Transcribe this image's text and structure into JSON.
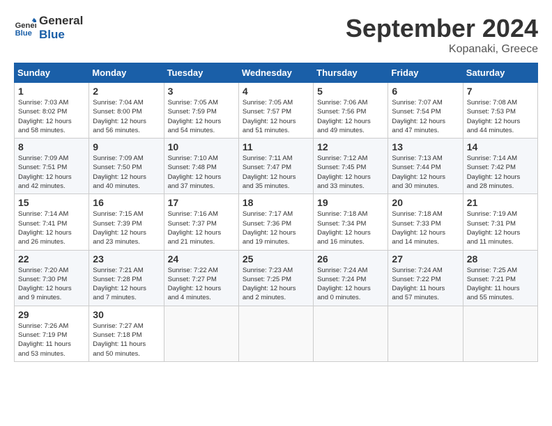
{
  "header": {
    "logo_line1": "General",
    "logo_line2": "Blue",
    "month_year": "September 2024",
    "location": "Kopanaki, Greece"
  },
  "weekdays": [
    "Sunday",
    "Monday",
    "Tuesday",
    "Wednesday",
    "Thursday",
    "Friday",
    "Saturday"
  ],
  "weeks": [
    [
      {
        "day": "1",
        "sunrise": "7:03 AM",
        "sunset": "8:02 PM",
        "daylight": "12 hours and 58 minutes."
      },
      {
        "day": "2",
        "sunrise": "7:04 AM",
        "sunset": "8:00 PM",
        "daylight": "12 hours and 56 minutes."
      },
      {
        "day": "3",
        "sunrise": "7:05 AM",
        "sunset": "7:59 PM",
        "daylight": "12 hours and 54 minutes."
      },
      {
        "day": "4",
        "sunrise": "7:05 AM",
        "sunset": "7:57 PM",
        "daylight": "12 hours and 51 minutes."
      },
      {
        "day": "5",
        "sunrise": "7:06 AM",
        "sunset": "7:56 PM",
        "daylight": "12 hours and 49 minutes."
      },
      {
        "day": "6",
        "sunrise": "7:07 AM",
        "sunset": "7:54 PM",
        "daylight": "12 hours and 47 minutes."
      },
      {
        "day": "7",
        "sunrise": "7:08 AM",
        "sunset": "7:53 PM",
        "daylight": "12 hours and 44 minutes."
      }
    ],
    [
      {
        "day": "8",
        "sunrise": "7:09 AM",
        "sunset": "7:51 PM",
        "daylight": "12 hours and 42 minutes."
      },
      {
        "day": "9",
        "sunrise": "7:09 AM",
        "sunset": "7:50 PM",
        "daylight": "12 hours and 40 minutes."
      },
      {
        "day": "10",
        "sunrise": "7:10 AM",
        "sunset": "7:48 PM",
        "daylight": "12 hours and 37 minutes."
      },
      {
        "day": "11",
        "sunrise": "7:11 AM",
        "sunset": "7:47 PM",
        "daylight": "12 hours and 35 minutes."
      },
      {
        "day": "12",
        "sunrise": "7:12 AM",
        "sunset": "7:45 PM",
        "daylight": "12 hours and 33 minutes."
      },
      {
        "day": "13",
        "sunrise": "7:13 AM",
        "sunset": "7:44 PM",
        "daylight": "12 hours and 30 minutes."
      },
      {
        "day": "14",
        "sunrise": "7:14 AM",
        "sunset": "7:42 PM",
        "daylight": "12 hours and 28 minutes."
      }
    ],
    [
      {
        "day": "15",
        "sunrise": "7:14 AM",
        "sunset": "7:41 PM",
        "daylight": "12 hours and 26 minutes."
      },
      {
        "day": "16",
        "sunrise": "7:15 AM",
        "sunset": "7:39 PM",
        "daylight": "12 hours and 23 minutes."
      },
      {
        "day": "17",
        "sunrise": "7:16 AM",
        "sunset": "7:37 PM",
        "daylight": "12 hours and 21 minutes."
      },
      {
        "day": "18",
        "sunrise": "7:17 AM",
        "sunset": "7:36 PM",
        "daylight": "12 hours and 19 minutes."
      },
      {
        "day": "19",
        "sunrise": "7:18 AM",
        "sunset": "7:34 PM",
        "daylight": "12 hours and 16 minutes."
      },
      {
        "day": "20",
        "sunrise": "7:18 AM",
        "sunset": "7:33 PM",
        "daylight": "12 hours and 14 minutes."
      },
      {
        "day": "21",
        "sunrise": "7:19 AM",
        "sunset": "7:31 PM",
        "daylight": "12 hours and 11 minutes."
      }
    ],
    [
      {
        "day": "22",
        "sunrise": "7:20 AM",
        "sunset": "7:30 PM",
        "daylight": "12 hours and 9 minutes."
      },
      {
        "day": "23",
        "sunrise": "7:21 AM",
        "sunset": "7:28 PM",
        "daylight": "12 hours and 7 minutes."
      },
      {
        "day": "24",
        "sunrise": "7:22 AM",
        "sunset": "7:27 PM",
        "daylight": "12 hours and 4 minutes."
      },
      {
        "day": "25",
        "sunrise": "7:23 AM",
        "sunset": "7:25 PM",
        "daylight": "12 hours and 2 minutes."
      },
      {
        "day": "26",
        "sunrise": "7:24 AM",
        "sunset": "7:24 PM",
        "daylight": "12 hours and 0 minutes."
      },
      {
        "day": "27",
        "sunrise": "7:24 AM",
        "sunset": "7:22 PM",
        "daylight": "11 hours and 57 minutes."
      },
      {
        "day": "28",
        "sunrise": "7:25 AM",
        "sunset": "7:21 PM",
        "daylight": "11 hours and 55 minutes."
      }
    ],
    [
      {
        "day": "29",
        "sunrise": "7:26 AM",
        "sunset": "7:19 PM",
        "daylight": "11 hours and 53 minutes."
      },
      {
        "day": "30",
        "sunrise": "7:27 AM",
        "sunset": "7:18 PM",
        "daylight": "11 hours and 50 minutes."
      },
      null,
      null,
      null,
      null,
      null
    ]
  ]
}
